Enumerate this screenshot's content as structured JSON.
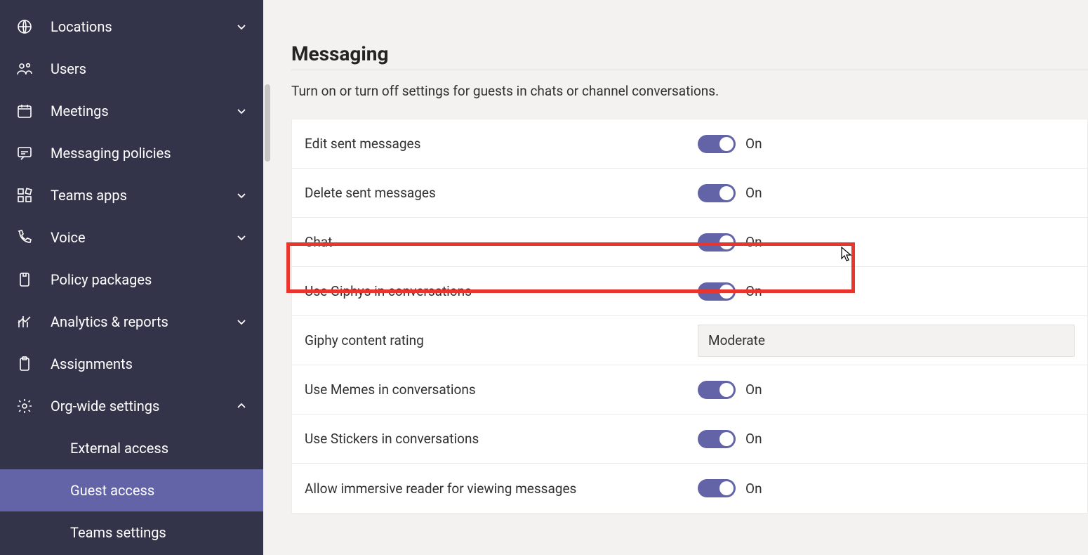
{
  "sidebar": {
    "items": [
      {
        "label": "Locations",
        "expandable": true
      },
      {
        "label": "Users",
        "expandable": false
      },
      {
        "label": "Meetings",
        "expandable": true
      },
      {
        "label": "Messaging policies",
        "expandable": false
      },
      {
        "label": "Teams apps",
        "expandable": true
      },
      {
        "label": "Voice",
        "expandable": true
      },
      {
        "label": "Policy packages",
        "expandable": false
      },
      {
        "label": "Analytics & reports",
        "expandable": true
      },
      {
        "label": "Assignments",
        "expandable": false
      },
      {
        "label": "Org-wide settings",
        "expandable": true
      }
    ],
    "orgwide_subitems": [
      {
        "label": "External access",
        "active": false
      },
      {
        "label": "Guest access",
        "active": true
      },
      {
        "label": "Teams settings",
        "active": false
      }
    ]
  },
  "main": {
    "section_title": "Messaging",
    "section_desc": "Turn on or turn off settings for guests in chats or channel conversations.",
    "toggle_on_text": "On",
    "settings": [
      {
        "label": "Edit sent messages",
        "type": "toggle",
        "state": "On"
      },
      {
        "label": "Delete sent messages",
        "type": "toggle",
        "state": "On"
      },
      {
        "label": "Chat",
        "type": "toggle",
        "state": "On",
        "highlighted": true
      },
      {
        "label": "Use Giphys in conversations",
        "type": "toggle",
        "state": "On"
      },
      {
        "label": "Giphy content rating",
        "type": "select",
        "value": "Moderate"
      },
      {
        "label": "Use Memes in conversations",
        "type": "toggle",
        "state": "On"
      },
      {
        "label": "Use Stickers in conversations",
        "type": "toggle",
        "state": "On"
      },
      {
        "label": "Allow immersive reader for viewing messages",
        "type": "toggle",
        "state": "On"
      }
    ]
  }
}
